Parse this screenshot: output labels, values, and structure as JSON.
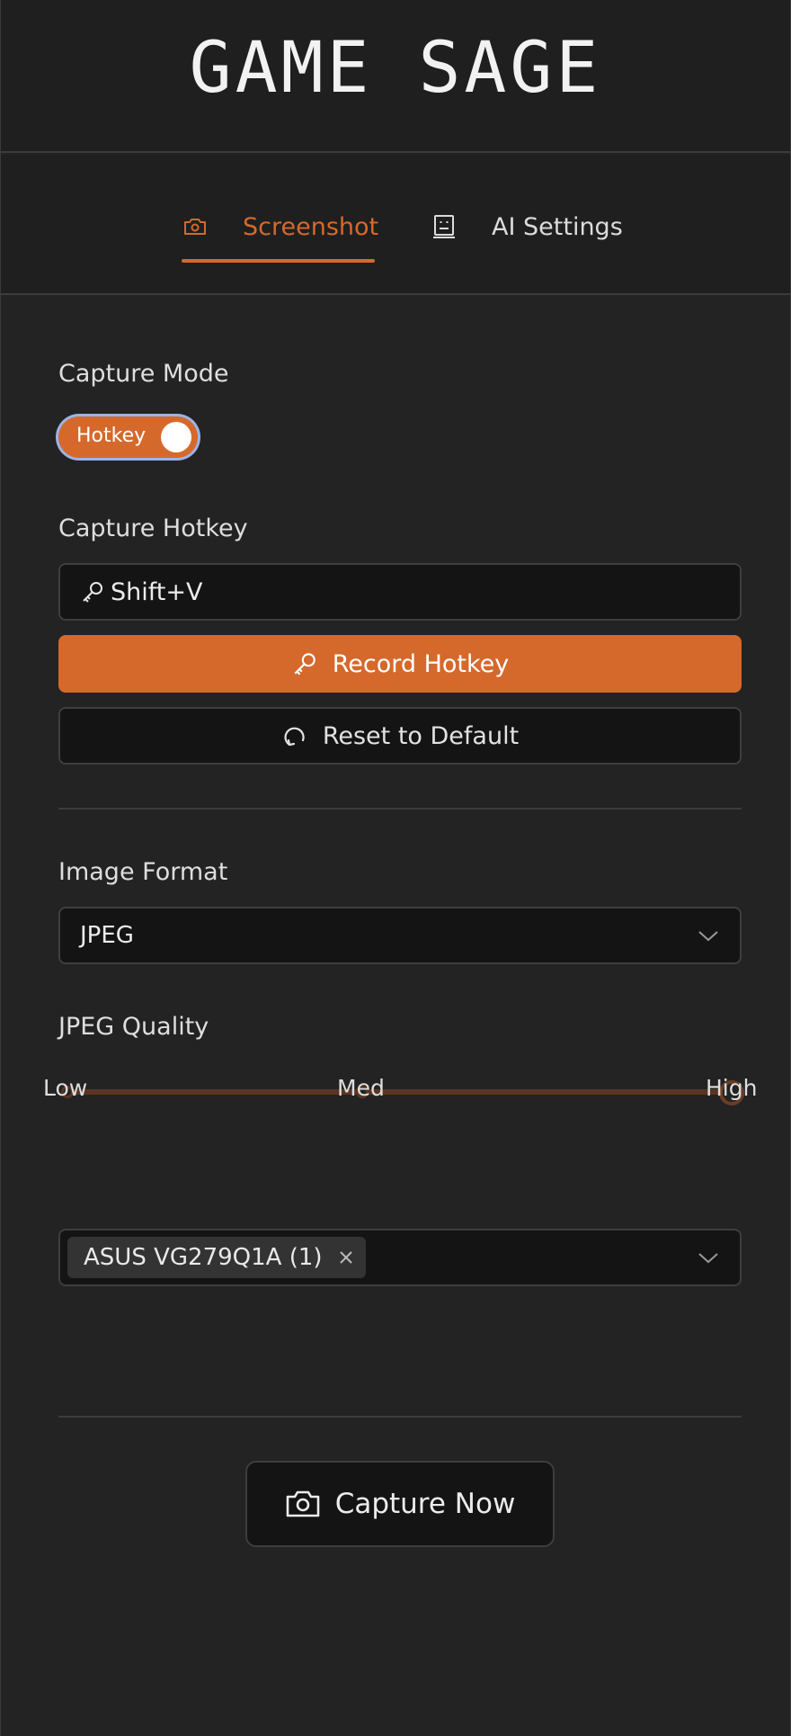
{
  "app": {
    "title": "GAME SAGE"
  },
  "tabs": [
    {
      "label": "Screenshot",
      "icon": "camera-icon",
      "active": true
    },
    {
      "label": "AI Settings",
      "icon": "robot-icon",
      "active": false
    }
  ],
  "capture_mode": {
    "label": "Capture Mode",
    "toggle_text": "Hotkey",
    "enabled": true
  },
  "hotkey": {
    "label": "Capture Hotkey",
    "value": "Shift+V",
    "record_label": "Record Hotkey",
    "reset_label": "Reset to Default"
  },
  "image_format": {
    "label": "Image Format",
    "selected": "JPEG"
  },
  "jpeg_quality": {
    "label": "JPEG Quality",
    "marks": [
      "Low",
      "Med",
      "High"
    ],
    "selected_index": 2
  },
  "monitor": {
    "selected_chip": "ASUS VG279Q1A (1)"
  },
  "capture_button": {
    "label": "Capture Now"
  },
  "colors": {
    "accent": "#d5692c",
    "background": "#232323",
    "header": "#1f1f1f",
    "field": "#141414",
    "focus_ring": "#9db2e6"
  }
}
